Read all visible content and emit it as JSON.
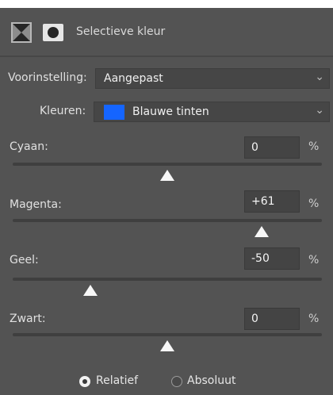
{
  "header": {
    "title": "Selectieve kleur",
    "adjustment_icon": "selective-color-adjustment-icon",
    "mask_icon": "layer-mask-icon"
  },
  "preset": {
    "label": "Voorinstelling:",
    "value": "Aangepast"
  },
  "colors": {
    "label": "Kleuren:",
    "value": "Blauwe tinten",
    "swatch_color": "#1565ff"
  },
  "sliders": [
    {
      "label": "Cyaan:",
      "value": "0",
      "unit": "%",
      "level": 0.5
    },
    {
      "label": "Magenta:",
      "value": "+61",
      "unit": "%",
      "level": 0.805
    },
    {
      "label": "Geel:",
      "value": "-50",
      "unit": "%",
      "level": 0.25
    },
    {
      "label": "Zwart:",
      "value": "0",
      "unit": "%",
      "level": 0.5
    }
  ],
  "method": {
    "relative_label": "Relatief",
    "absolute_label": "Absoluut",
    "selected": "relative"
  }
}
